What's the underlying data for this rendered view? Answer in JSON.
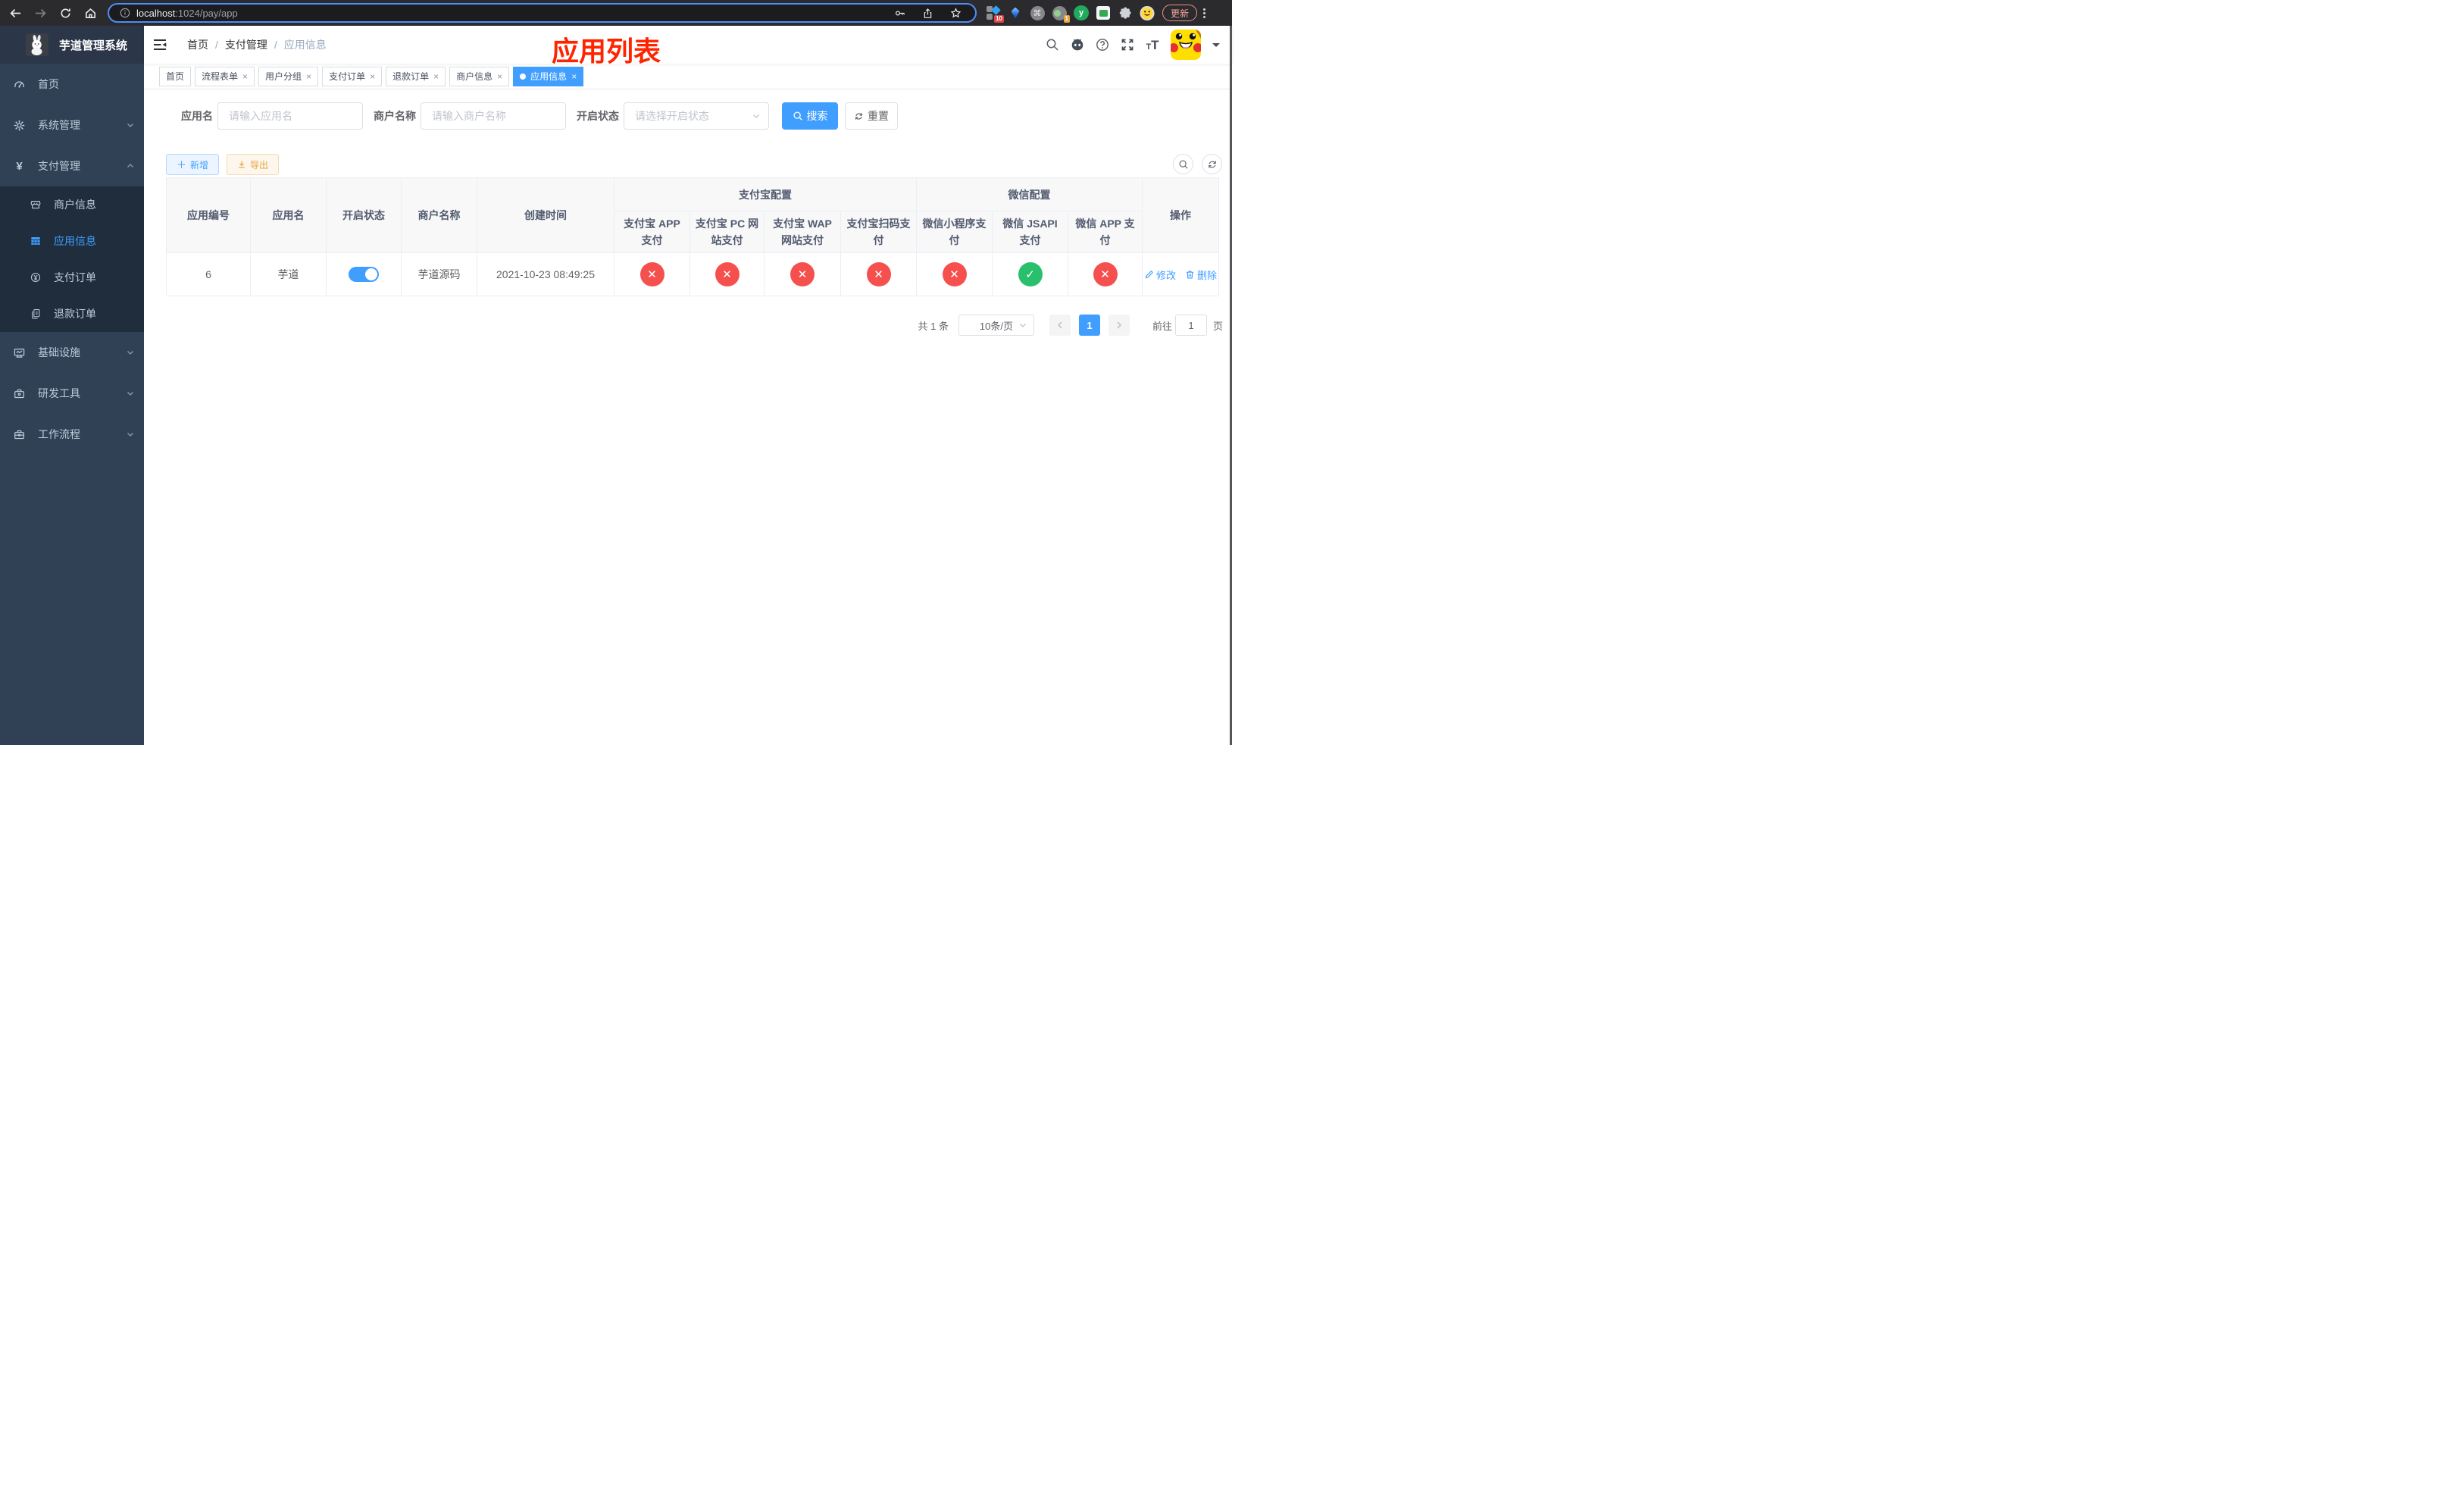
{
  "browser": {
    "url_host": "localhost",
    "url_rest": ":1024/pay/app",
    "update_label": "更新",
    "ext_badge_1": "10",
    "ext_badge_4": "1",
    "ext5_letter": "y",
    "command_glyph": "⌘"
  },
  "sidebar": {
    "title": "芋道管理系统",
    "items": [
      {
        "icon": "dashboard",
        "label": "首页",
        "type": "top"
      },
      {
        "icon": "gear",
        "label": "系统管理",
        "type": "top",
        "chevron": "down"
      },
      {
        "icon": "yen",
        "label": "支付管理",
        "type": "top",
        "chevron": "up"
      },
      {
        "icon": "store",
        "label": "商户信息",
        "type": "sub"
      },
      {
        "icon": "grid",
        "label": "应用信息",
        "type": "sub",
        "active": true
      },
      {
        "icon": "yen-circle",
        "label": "支付订单",
        "type": "sub"
      },
      {
        "icon": "document",
        "label": "退款订单",
        "type": "sub"
      },
      {
        "icon": "monitor",
        "label": "基础设施",
        "type": "top",
        "chevron": "down"
      },
      {
        "icon": "toolbox",
        "label": "研发工具",
        "type": "top",
        "chevron": "down"
      },
      {
        "icon": "briefcase",
        "label": "工作流程",
        "type": "top",
        "chevron": "down"
      }
    ]
  },
  "navbar": {
    "breadcrumb": [
      "首页",
      "支付管理",
      "应用信息"
    ],
    "separator": "/",
    "annotation": "应用列表"
  },
  "tabs": [
    {
      "label": "首页",
      "closable": false,
      "active": false
    },
    {
      "label": "流程表单",
      "closable": true,
      "active": false
    },
    {
      "label": "用户分组",
      "closable": true,
      "active": false
    },
    {
      "label": "支付订单",
      "closable": true,
      "active": false
    },
    {
      "label": "退款订单",
      "closable": true,
      "active": false
    },
    {
      "label": "商户信息",
      "closable": true,
      "active": false
    },
    {
      "label": "应用信息",
      "closable": true,
      "active": true
    }
  ],
  "filters": {
    "app_name": {
      "label": "应用名",
      "placeholder": "请输入应用名"
    },
    "merchant": {
      "label": "商户名称",
      "placeholder": "请输入商户名称"
    },
    "status": {
      "label": "开启状态",
      "placeholder": "请选择开启状态"
    },
    "search": "搜索",
    "reset": "重置"
  },
  "toolbar": {
    "add": "新增",
    "export": "导出"
  },
  "table": {
    "simple_columns": [
      "应用编号",
      "应用名",
      "开启状态",
      "商户名称",
      "创建时间"
    ],
    "alipay_group": "支付宝配置",
    "wechat_group": "微信配置",
    "alipay_columns": [
      "支付宝 APP 支付",
      "支付宝 PC 网站支付",
      "支付宝 WAP 网站支付",
      "支付宝扫码支付"
    ],
    "wechat_columns": [
      "微信小程序支付",
      "微信 JSAPI 支付",
      "微信 APP 支付"
    ],
    "op_column": "操作",
    "row": {
      "id": "6",
      "name": "芋道",
      "enabled": true,
      "merchant": "芋道源码",
      "created": "2021-10-23 08:49:25",
      "statuses": [
        false,
        false,
        false,
        false,
        false,
        true,
        false
      ]
    },
    "actions": {
      "edit": "修改",
      "delete": "删除"
    },
    "status_icons": {
      "yes": "✓",
      "no": "✕"
    }
  },
  "pagination": {
    "total": "共 1 条",
    "page_size": "10条/页",
    "current": "1",
    "goto_label": "前往",
    "goto_value": "1",
    "page_suffix": "页"
  },
  "colors": {
    "accent": "#409eff",
    "success": "#29c06d",
    "danger": "#f5504e",
    "warning": "#e6a23c",
    "annotation_red": "#ff2400",
    "sidebar_bg": "#304156",
    "submenu_bg": "#1f2d3d"
  }
}
